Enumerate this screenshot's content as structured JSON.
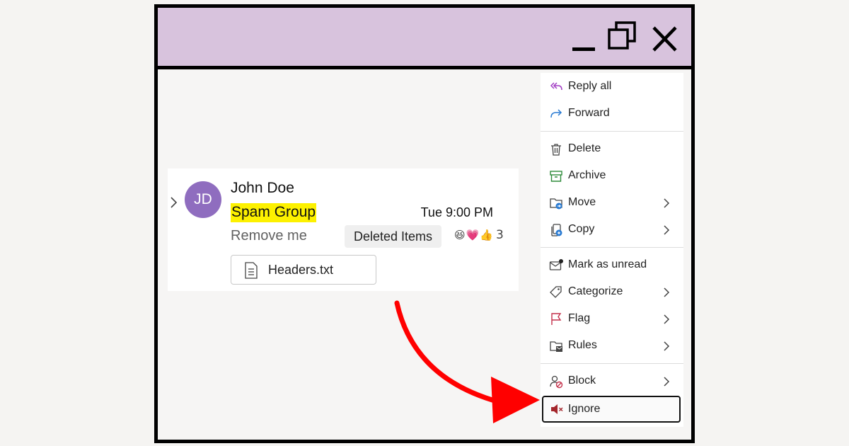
{
  "window": {
    "controls": {
      "minimize": "minimize-icon",
      "restore": "restore-icon",
      "close": "close-icon"
    },
    "titlebar_color": "#d8c3dd"
  },
  "message": {
    "avatar_initials": "JD",
    "avatar_color": "#8f6dbf",
    "sender": "John Doe",
    "subject": "Spam Group",
    "subject_highlight_color": "#fdf100",
    "time": "Tue 9:00 PM",
    "preview": "Remove me",
    "folder": "Deleted Items",
    "reactions": {
      "emojis": [
        "😆",
        "💗",
        "👍"
      ],
      "count": "3"
    },
    "attachment": {
      "name": "Headers.txt",
      "icon": "text-file-icon"
    }
  },
  "context_menu": {
    "items": [
      {
        "id": "reply-all",
        "label": "Reply all",
        "icon": "reply-all-icon",
        "submenu": false
      },
      {
        "id": "forward",
        "label": "Forward",
        "icon": "forward-icon",
        "submenu": false
      },
      {
        "id": "delete",
        "label": "Delete",
        "icon": "trash-icon",
        "submenu": false
      },
      {
        "id": "archive",
        "label": "Archive",
        "icon": "archive-icon",
        "submenu": false
      },
      {
        "id": "move",
        "label": "Move",
        "icon": "move-folder-icon",
        "submenu": true
      },
      {
        "id": "copy",
        "label": "Copy",
        "icon": "copy-icon",
        "submenu": true
      },
      {
        "id": "mark-unread",
        "label": "Mark as unread",
        "icon": "envelope-unread-icon",
        "submenu": false
      },
      {
        "id": "categorize",
        "label": "Categorize",
        "icon": "tag-icon",
        "submenu": true
      },
      {
        "id": "flag",
        "label": "Flag",
        "icon": "flag-icon",
        "submenu": true
      },
      {
        "id": "rules",
        "label": "Rules",
        "icon": "rules-folder-icon",
        "submenu": true
      },
      {
        "id": "block",
        "label": "Block",
        "icon": "block-user-icon",
        "submenu": true
      },
      {
        "id": "ignore",
        "label": "Ignore",
        "icon": "mute-speaker-icon",
        "submenu": false,
        "highlighted": true
      }
    ]
  },
  "annotation": {
    "arrow_color": "#ff0000",
    "icon": "red-curved-arrow-icon"
  }
}
